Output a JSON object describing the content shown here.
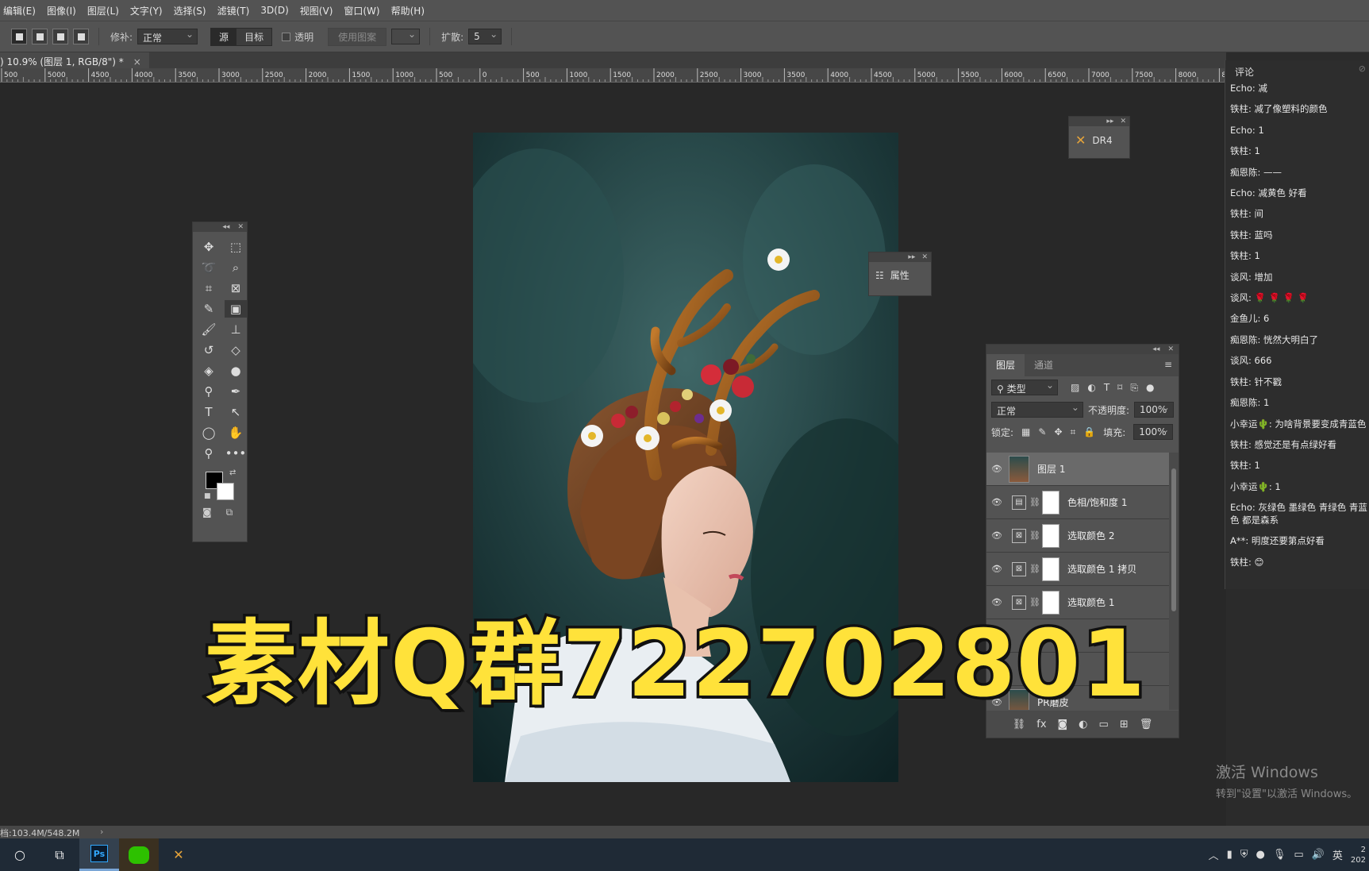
{
  "menu": [
    "编辑(E)",
    "图像(I)",
    "图层(L)",
    "文字(Y)",
    "选择(S)",
    "滤镜(T)",
    "3D(D)",
    "视图(V)",
    "窗口(W)",
    "帮助(H)"
  ],
  "options": {
    "patch_label": "修补:",
    "patch_mode": "正常",
    "source": "源",
    "target": "目标",
    "transparent": "透明",
    "use_pattern": "使用图案",
    "diffusion_label": "扩散:",
    "diffusion_value": "5"
  },
  "document": {
    "tab_title": ") 10.9% (图层 1, RGB/8\") *",
    "close": "×"
  },
  "ruler_labels": [
    "500",
    "5000",
    "4500",
    "4000",
    "3500",
    "3000",
    "2500",
    "2000",
    "1500",
    "1000",
    "500",
    "0",
    "500",
    "1000",
    "1500",
    "2000",
    "2500",
    "3000",
    "3500",
    "4000",
    "4500",
    "5000",
    "5500",
    "6000",
    "6500",
    "7000",
    "7500",
    "8000",
    "850"
  ],
  "panels": {
    "dr4": "DR4",
    "properties": "属性"
  },
  "layers_panel": {
    "tabs": [
      "图层",
      "通道"
    ],
    "filter_kind": "类型",
    "blend_mode": "正常",
    "opacity_label": "不透明度:",
    "opacity_value": "100%",
    "lock_label": "锁定:",
    "fill_label": "填充:",
    "fill_value": "100%",
    "layers": [
      {
        "name": "图层 1",
        "kind": "pixel",
        "selected": true
      },
      {
        "name": "色相/饱和度 1",
        "kind": "adjust"
      },
      {
        "name": "选取颜色 2",
        "kind": "adjust"
      },
      {
        "name": "选取颜色 1 拷贝",
        "kind": "adjust"
      },
      {
        "name": "选取颜色 1",
        "kind": "adjust"
      },
      {
        "name": "",
        "kind": "hidden"
      },
      {
        "name": "",
        "kind": "hidden"
      },
      {
        "name": "PR磨皮",
        "kind": "pixel"
      }
    ]
  },
  "comments": {
    "title": "评论",
    "messages": [
      "Echo: 减",
      "铁柱: 减了像塑料的颜色",
      "Echo: 1",
      "铁柱: 1",
      "痴恩陈: ——",
      "Echo: 减黄色 好看",
      "铁柱: 间",
      "铁柱: 蓝吗",
      "铁柱: 1",
      "谈风: 增加",
      "谈风: 🌹 🌹 🌹 🌹",
      "金鱼儿: 6",
      "痴恩陈: 恍然大明白了",
      "谈风: 666",
      "铁柱: 针不戳",
      "痴恩陈: 1",
      "小幸运🌵: 为啥背景要变成青蓝色",
      "铁柱: 感觉还是有点绿好看",
      "铁柱: 1",
      "小幸运🌵: 1",
      "Echo: 灰绿色 墨绿色 青绿色 青蓝色 都是森系",
      "A**: 明度还要第点好看",
      "铁柱: 😊"
    ]
  },
  "status": {
    "doc_size": "档:103.4M/548.2M"
  },
  "watermark": "素材Q群722702801",
  "activation": {
    "line1": "激活 Windows",
    "line2": "转到\"设置\"以激活 Windows。"
  },
  "taskbar": {
    "ps": "Ps",
    "ime": "英",
    "clock_line1": "2",
    "clock_line2": "202"
  },
  "colors": {
    "watermark_fill": "#ffe23a",
    "foreground": "#000000",
    "background": "#ffffff"
  }
}
